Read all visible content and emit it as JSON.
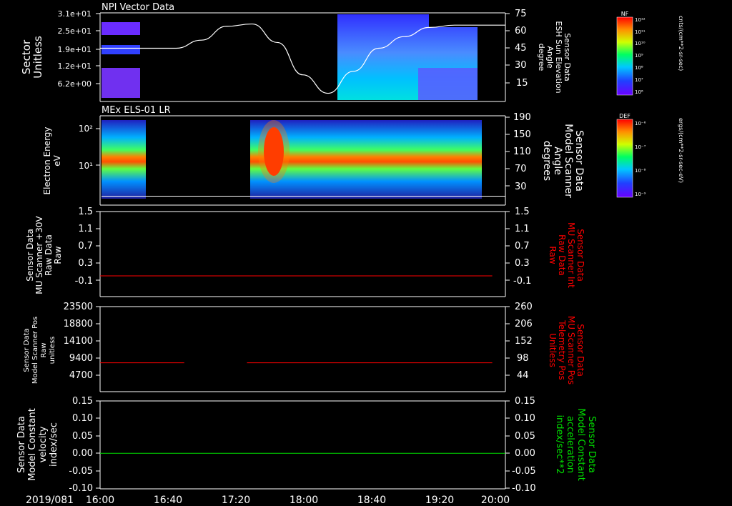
{
  "colors": {
    "background": "#000000",
    "axis": "#ffffff",
    "red_trace": "#ff0000",
    "green_trace": "#00dd00",
    "white_trace": "#ffffff"
  },
  "footer": {
    "date": "2019/081",
    "time_ticks": [
      "16:00",
      "16:40",
      "17:20",
      "18:00",
      "18:40",
      "19:20",
      "20:00"
    ]
  },
  "chart_data": [
    {
      "type": "heatmap",
      "title": "NPI Vector Data",
      "ylabel": [
        "Sector",
        "Unitless"
      ],
      "y_ticks": [
        "3.1e+01",
        "2.5e+01",
        "1.9e+01",
        "1.2e+01",
        "6.2e+00"
      ],
      "right_ylabel": [
        "Sensor Data",
        "ESH Sun Elevation",
        "Angle",
        "degree"
      ],
      "right_ticks": [
        "75",
        "60",
        "45",
        "30",
        "15"
      ],
      "right_ylim": [
        0,
        75
      ],
      "overlay_line": {
        "name": "ESH Sun Elevation Angle",
        "x_hours": [
          16.0,
          16.75,
          17.0,
          17.25,
          17.5,
          17.75,
          18.0,
          18.25,
          18.5,
          18.75,
          19.0,
          19.25,
          19.5,
          20.0
        ],
        "y": [
          45,
          45,
          52,
          64,
          66,
          50,
          22,
          6,
          25,
          45,
          55,
          63,
          65,
          65
        ]
      },
      "colorbar": {
        "label": "NF",
        "units": "cnts/(cm**2-sr-sec)",
        "ticks": [
          "10¹²",
          "10¹¹",
          "10¹⁰",
          "10⁹",
          "10⁸",
          "10⁷",
          "10⁶"
        ]
      },
      "data_coverage_hours": [
        [
          16.0,
          16.67
        ],
        [
          18.65,
          19.92
        ]
      ]
    },
    {
      "type": "heatmap",
      "title": "MEx ELS-01 LR",
      "ylabel": [
        "Electron Energy",
        "eV"
      ],
      "y_ticks": [
        "10²",
        "10¹"
      ],
      "right_ylabel": [
        "Sensor Data",
        "Model Scanner",
        "Angle",
        "degrees"
      ],
      "right_ticks": [
        "190",
        "150",
        "110",
        "70",
        "30"
      ],
      "colorbar": {
        "label": "DEF",
        "units": "ergs/(cm**2-sr-sec-eV)",
        "ticks": [
          "10⁻⁶",
          "10⁻⁷",
          "10⁻⁸",
          "10⁻⁹"
        ]
      },
      "data_coverage_hours": [
        [
          16.0,
          16.8
        ],
        [
          17.4,
          19.8
        ]
      ]
    },
    {
      "type": "line",
      "ylabel": [
        "Sensor Data",
        "MU Scanner +30V",
        "Raw Data",
        "Raw"
      ],
      "y_ticks": [
        "1.5",
        "1.1",
        "0.7",
        "0.3",
        "-0.1"
      ],
      "right_ylabel": [
        "Sensor Data",
        "MU Scanner Int",
        "Raw Data",
        "Raw"
      ],
      "right_ticks": [
        "1.5",
        "1.1",
        "0.7",
        "0.3",
        "-0.1"
      ],
      "ylim": [
        -0.3,
        1.5
      ],
      "series": [
        {
          "x_hours": [
            16.0,
            19.87
          ],
          "y": [
            0.0,
            0.0
          ]
        }
      ]
    },
    {
      "type": "line",
      "ylabel": [
        "Sensor Data",
        "Model Scanner Pos",
        "Raw",
        "unitless"
      ],
      "y_ticks": [
        "23500",
        "18800",
        "14100",
        "9400",
        "4700"
      ],
      "right_ylabel": [
        "Sensor Data",
        "MU Scanner Pos",
        "Telemetry Pos",
        "Unitless"
      ],
      "right_ticks": [
        "260",
        "206",
        "152",
        "98",
        "44"
      ],
      "ylim": [
        0,
        23500
      ],
      "series": [
        {
          "x_hours": [
            16.0,
            16.83
          ],
          "y": [
            8100,
            8100
          ]
        },
        {
          "x_hours": [
            17.45,
            19.87
          ],
          "y": [
            8100,
            8100
          ]
        }
      ]
    },
    {
      "type": "line",
      "ylabel": [
        "Sensor Data",
        "Model Constant",
        "velocity",
        "index/sec"
      ],
      "y_ticks": [
        "0.15",
        "0.10",
        "0.05",
        "0.00",
        "-0.05",
        "-0.10"
      ],
      "right_ylabel": [
        "Sensor Data",
        "Model Constant",
        "acceleration",
        "index/sec**2"
      ],
      "right_ticks": [
        "0.15",
        "0.10",
        "0.05",
        "0.00",
        "-0.05",
        "-0.10"
      ],
      "ylim": [
        -0.1,
        0.15
      ],
      "series": [
        {
          "x_hours": [
            16.0,
            20.0
          ],
          "y": [
            0.0,
            0.0
          ]
        }
      ]
    }
  ]
}
